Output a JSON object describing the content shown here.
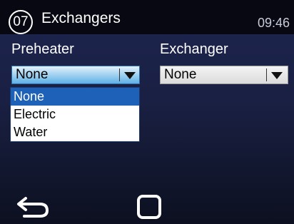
{
  "header": {
    "badge": "07",
    "title": "Exchangers",
    "time": "09:46"
  },
  "preheater": {
    "label": "Preheater",
    "value": "None",
    "options": [
      "None",
      "Electric",
      "Water"
    ],
    "selected_index": 0
  },
  "exchanger": {
    "label": "Exchanger",
    "value": "None"
  },
  "footer": {
    "back_icon": "back-arrow-icon",
    "home_icon": "square-icon"
  },
  "colors": {
    "titlebar": "#070812",
    "background": "#1d2550",
    "selection": "#1e61b8",
    "focused_combo": "#5fb1e6"
  }
}
